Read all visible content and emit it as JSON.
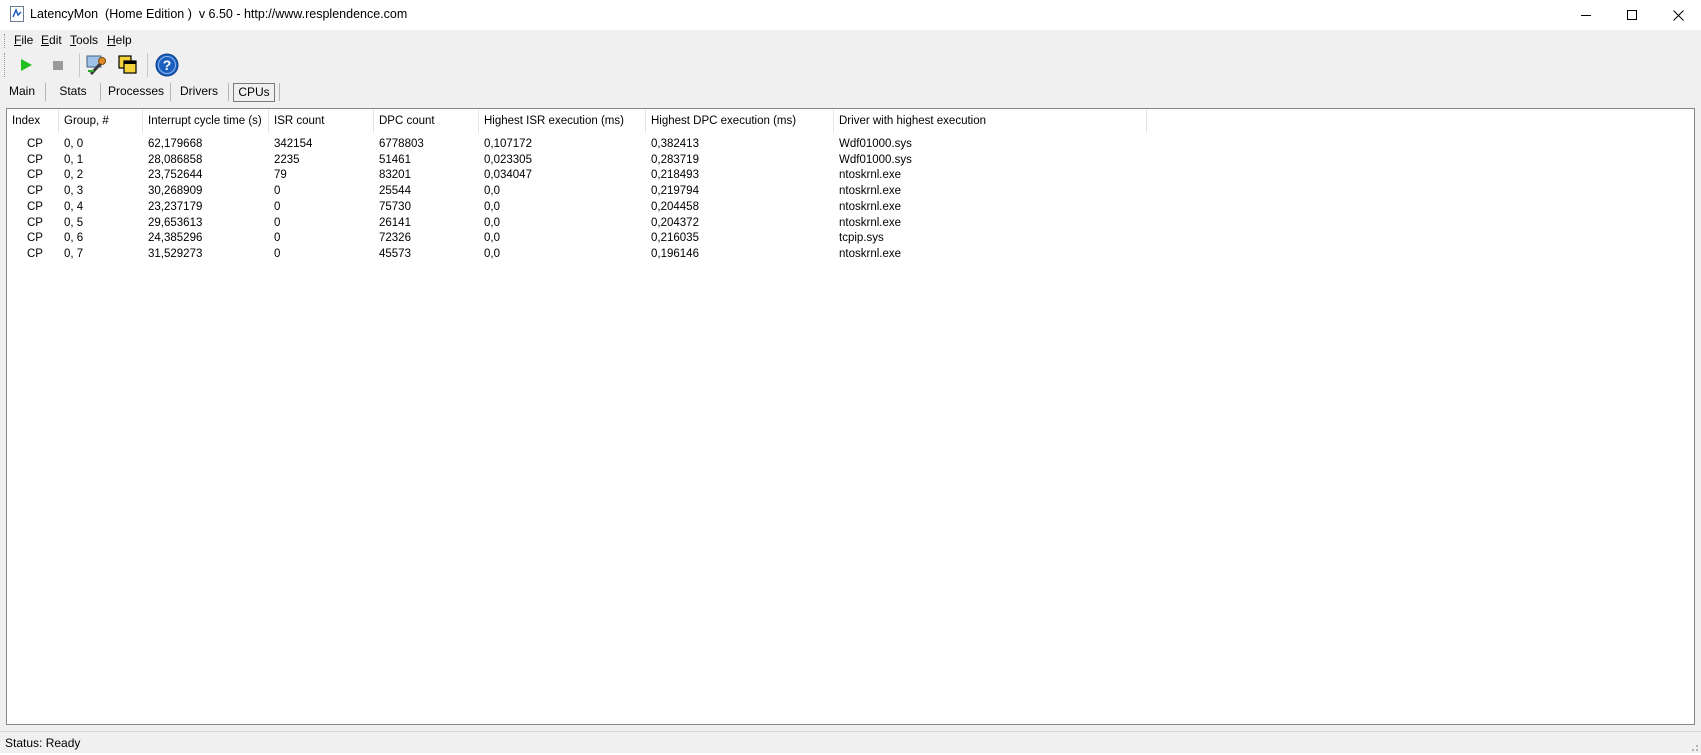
{
  "window": {
    "title": "LatencyMon  (Home Edition )  v 6.50 - http://www.resplendence.com"
  },
  "menu": [
    {
      "label": "File"
    },
    {
      "label": "Edit"
    },
    {
      "label": "Tools"
    },
    {
      "label": "Help"
    }
  ],
  "toolbar": {
    "icons": [
      "play-icon",
      "stop-icon",
      "wrench-icon",
      "window-copy-icon",
      "help-icon"
    ],
    "colors": {
      "play": "#22c020",
      "stop": "#9a9a9a",
      "help": "#1b5fbf"
    }
  },
  "tabs": [
    {
      "label": "Main",
      "active": false
    },
    {
      "label": "Stats",
      "active": false
    },
    {
      "label": "Processes",
      "active": false
    },
    {
      "label": "Drivers",
      "active": false
    },
    {
      "label": "CPUs",
      "active": true
    }
  ],
  "table": {
    "columns": [
      "Index",
      "Group, #",
      "Interrupt cycle time (s)",
      "ISR count",
      "DPC count",
      "Highest ISR execution (ms)",
      "Highest DPC execution (ms)",
      "Driver with highest execution"
    ],
    "rows": [
      [
        "CP",
        "0, 0",
        "62,179668",
        "342154",
        "6778803",
        "0,107172",
        "0,382413",
        "Wdf01000.sys"
      ],
      [
        "CP",
        "0, 1",
        "28,086858",
        "2235",
        "51461",
        "0,023305",
        "0,283719",
        "Wdf01000.sys"
      ],
      [
        "CP",
        "0, 2",
        "23,752644",
        "79",
        "83201",
        "0,034047",
        "0,218493",
        "ntoskrnl.exe"
      ],
      [
        "CP",
        "0, 3",
        "30,268909",
        "0",
        "25544",
        "0,0",
        "0,219794",
        "ntoskrnl.exe"
      ],
      [
        "CP",
        "0, 4",
        "23,237179",
        "0",
        "75730",
        "0,0",
        "0,204458",
        "ntoskrnl.exe"
      ],
      [
        "CP",
        "0, 5",
        "29,653613",
        "0",
        "26141",
        "0,0",
        "0,204372",
        "ntoskrnl.exe"
      ],
      [
        "CP",
        "0, 6",
        "24,385296",
        "0",
        "72326",
        "0,0",
        "0,216035",
        "tcpip.sys"
      ],
      [
        "CP",
        "0, 7",
        "31,529273",
        "0",
        "45573",
        "0,0",
        "0,196146",
        "ntoskrnl.exe"
      ]
    ]
  },
  "status": {
    "text": "Status: Ready"
  }
}
